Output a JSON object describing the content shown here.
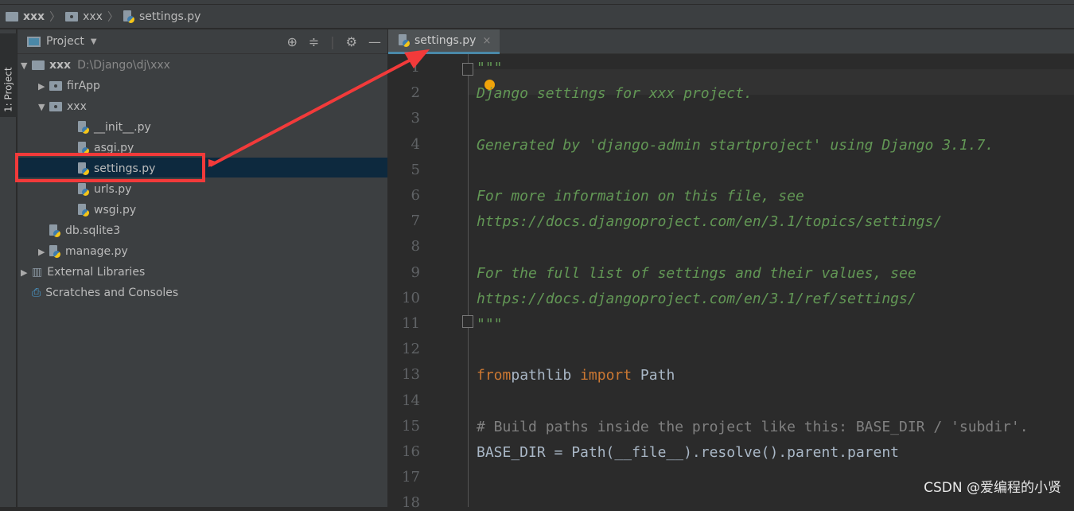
{
  "breadcrumb": [
    "xxx",
    "xxx",
    "settings.py"
  ],
  "side_tab": "1: Project",
  "panel": {
    "title": "Project",
    "icons": [
      "locate-icon",
      "collapse-all-icon",
      "gear-icon",
      "minimize-icon"
    ]
  },
  "tree": [
    {
      "label": "xxx",
      "path": "D:\\Django\\dj\\xxx",
      "icon": "folder",
      "level": 0,
      "arrow": "▼"
    },
    {
      "label": "firApp",
      "icon": "package",
      "level": 1,
      "arrow": "▶"
    },
    {
      "label": "xxx",
      "icon": "package",
      "level": 1,
      "arrow": "▼"
    },
    {
      "label": "__init__.py",
      "icon": "python",
      "level": 2
    },
    {
      "label": "asgi.py",
      "icon": "python",
      "level": 2
    },
    {
      "label": "settings.py",
      "icon": "python",
      "level": 2,
      "selected": true
    },
    {
      "label": "urls.py",
      "icon": "python",
      "level": 2
    },
    {
      "label": "wsgi.py",
      "icon": "python",
      "level": 2
    },
    {
      "label": "db.sqlite3",
      "icon": "file",
      "level": 1
    },
    {
      "label": "manage.py",
      "icon": "python",
      "level": 1,
      "arrow": "▶"
    },
    {
      "label": "External Libraries",
      "icon": "library",
      "level": 0,
      "arrow": "▶"
    },
    {
      "label": "Scratches and Consoles",
      "icon": "scratches",
      "level": 0
    }
  ],
  "editor": {
    "tab": "settings.py",
    "tab_close": "×",
    "line_numbers": [
      "1",
      "2",
      "3",
      "4",
      "5",
      "6",
      "7",
      "8",
      "9",
      "10",
      "11",
      "12",
      "13",
      "14",
      "15",
      "16",
      "17",
      "18"
    ],
    "lines": [
      [
        [
          "doc",
          "\"\"\""
        ]
      ],
      [
        [
          "doc",
          "Django settings for xxx project."
        ]
      ],
      [],
      [
        [
          "doc",
          "Generated by 'django-admin startproject' using Django 3.1.7."
        ]
      ],
      [],
      [
        [
          "doc",
          "For more information on this file, see"
        ]
      ],
      [
        [
          "doc",
          "https://docs.djangoproject.com/en/3.1/topics/settings/"
        ]
      ],
      [],
      [
        [
          "doc",
          "For the full list of settings and their values, see"
        ]
      ],
      [
        [
          "doc",
          "https://docs.djangoproject.com/en/3.1/ref/settings/"
        ]
      ],
      [
        [
          "doc",
          "\"\"\""
        ]
      ],
      [],
      [
        [
          "kw",
          "from"
        ],
        [
          "",
          "pathlib "
        ],
        [
          "kw",
          "import"
        ],
        [
          "",
          " Path"
        ]
      ],
      [],
      [
        [
          "cm",
          "# Build paths inside the project like this: BASE_DIR / 'subdir'."
        ]
      ],
      [
        [
          "",
          "BASE_DIR = Path(__file__).resolve().parent.parent"
        ]
      ],
      [],
      []
    ]
  },
  "watermark": "CSDN @爱编程的小贤",
  "annotation_color": "#f23a3a"
}
